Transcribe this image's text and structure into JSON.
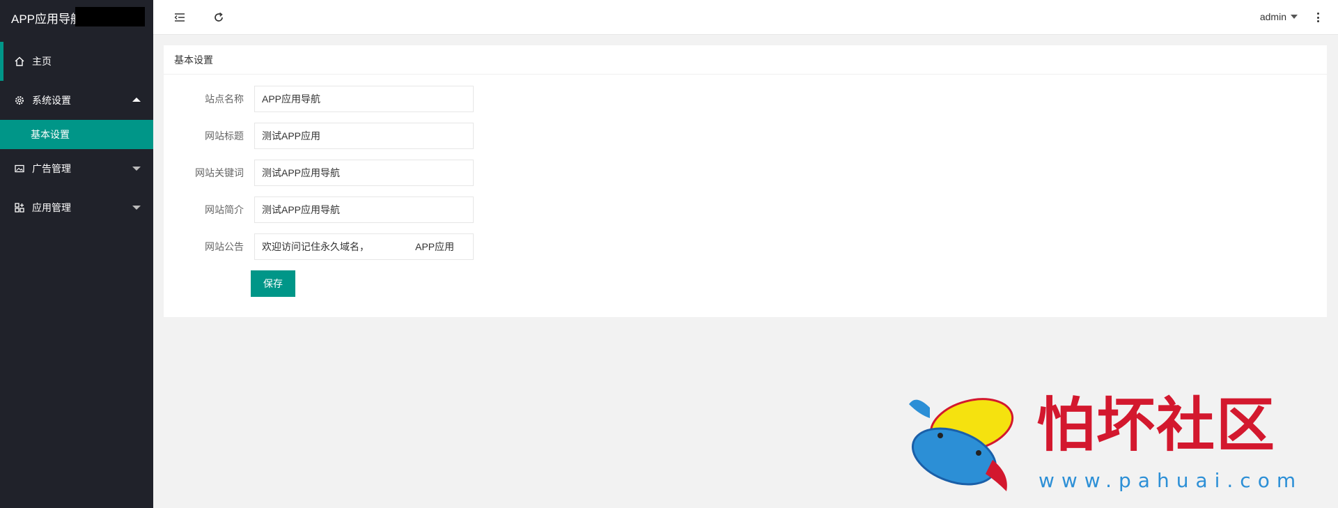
{
  "app": {
    "title": "APP应用导航"
  },
  "sidebar": {
    "items": [
      {
        "label": "主页",
        "icon": "home-icon"
      },
      {
        "label": "系统设置",
        "icon": "gear-icon",
        "expanded": true,
        "children": [
          {
            "label": "基本设置",
            "active": true
          }
        ]
      },
      {
        "label": "广告管理",
        "icon": "image-icon",
        "expanded": false
      },
      {
        "label": "应用管理",
        "icon": "apps-icon",
        "expanded": false
      }
    ]
  },
  "header": {
    "collapse_icon": "menu-collapse-icon",
    "refresh_icon": "refresh-icon",
    "user": "admin",
    "more_icon": "more-vertical-icon"
  },
  "card": {
    "title": "基本设置",
    "fields": [
      {
        "label": "站点名称",
        "value": "APP应用导航"
      },
      {
        "label": "网站标题",
        "value": "测试APP应用"
      },
      {
        "label": "网站关键词",
        "value": "测试APP应用导航"
      },
      {
        "label": "网站简介",
        "value": "测试APP应用导航"
      },
      {
        "label": "网站公告",
        "value": "欢迎访问记住永久域名，                 APP应用"
      }
    ],
    "save_label": "保存"
  },
  "watermark": {
    "text": "怕坏社区",
    "url": "www.pahuai.com"
  },
  "colors": {
    "accent": "#009688",
    "sidebar_bg": "#20222a",
    "page_bg": "#f2f2f2",
    "watermark_red": "#d3182e",
    "watermark_blue": "#2c8fd6"
  }
}
